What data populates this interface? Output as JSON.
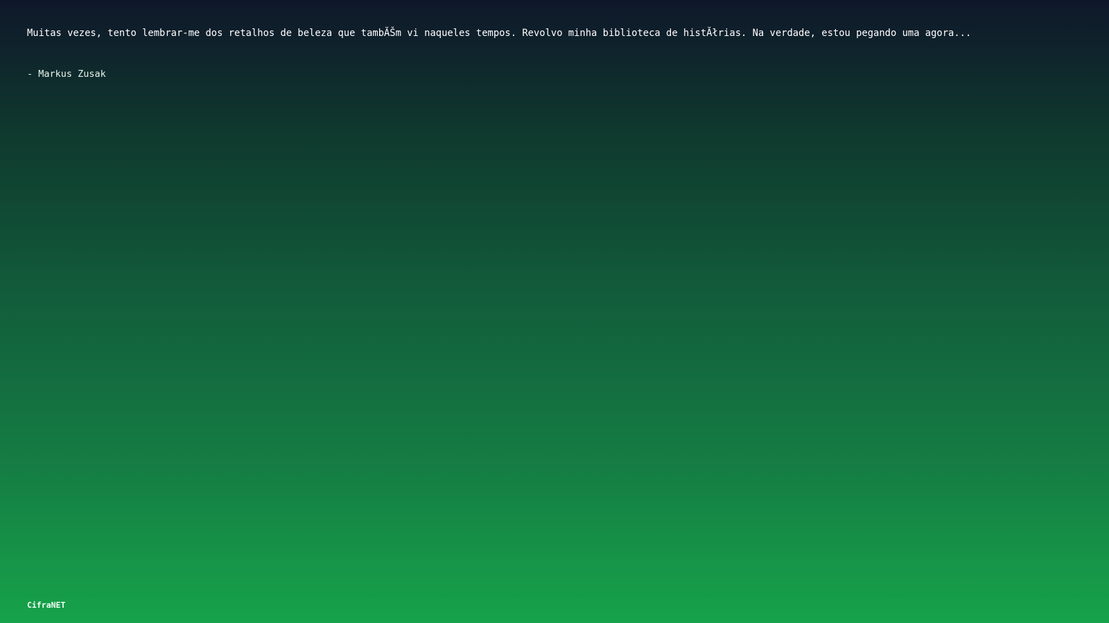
{
  "quote": {
    "text": "Muitas vezes, tento lembrar-me dos retalhos de beleza que tambĂŠm vi naqueles tempos. Revolvo minha biblioteca de histĂłrias. Na verdade, estou pegando uma agora...",
    "author": "- Markus Zusak"
  },
  "footer": {
    "brand": "CifraNET"
  },
  "colors": {
    "gradient_top": "#0f172a",
    "gradient_bottom": "#16a34a",
    "text": "#ffffff"
  }
}
